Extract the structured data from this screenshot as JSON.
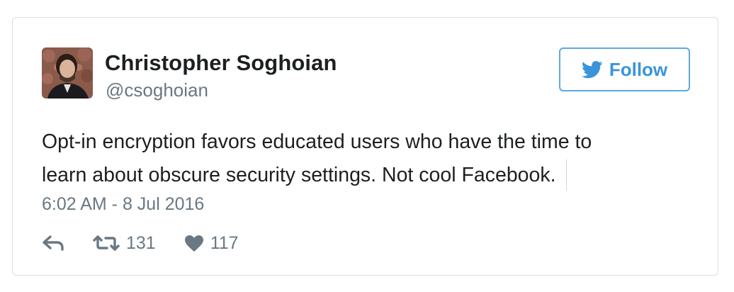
{
  "author": {
    "name": "Christopher Soghoian",
    "handle": "@csoghoian"
  },
  "follow_button": {
    "label": "Follow",
    "icon": "twitter-bird-icon"
  },
  "tweet": {
    "text_lines": [
      "Opt-in encryption favors educated users who have the time to",
      "learn about obscure security settings. Not cool Facebook."
    ],
    "timestamp": "6:02 AM - 8 Jul 2016"
  },
  "actions": {
    "reply": {
      "icon": "reply-icon"
    },
    "retweet": {
      "icon": "retweet-icon",
      "count": "131"
    },
    "like": {
      "icon": "heart-icon",
      "count": "117"
    }
  },
  "colors": {
    "accent": "#3b94d9",
    "secondary_text": "#697882",
    "primary_text": "#1c2022",
    "border": "#d8dde2"
  }
}
